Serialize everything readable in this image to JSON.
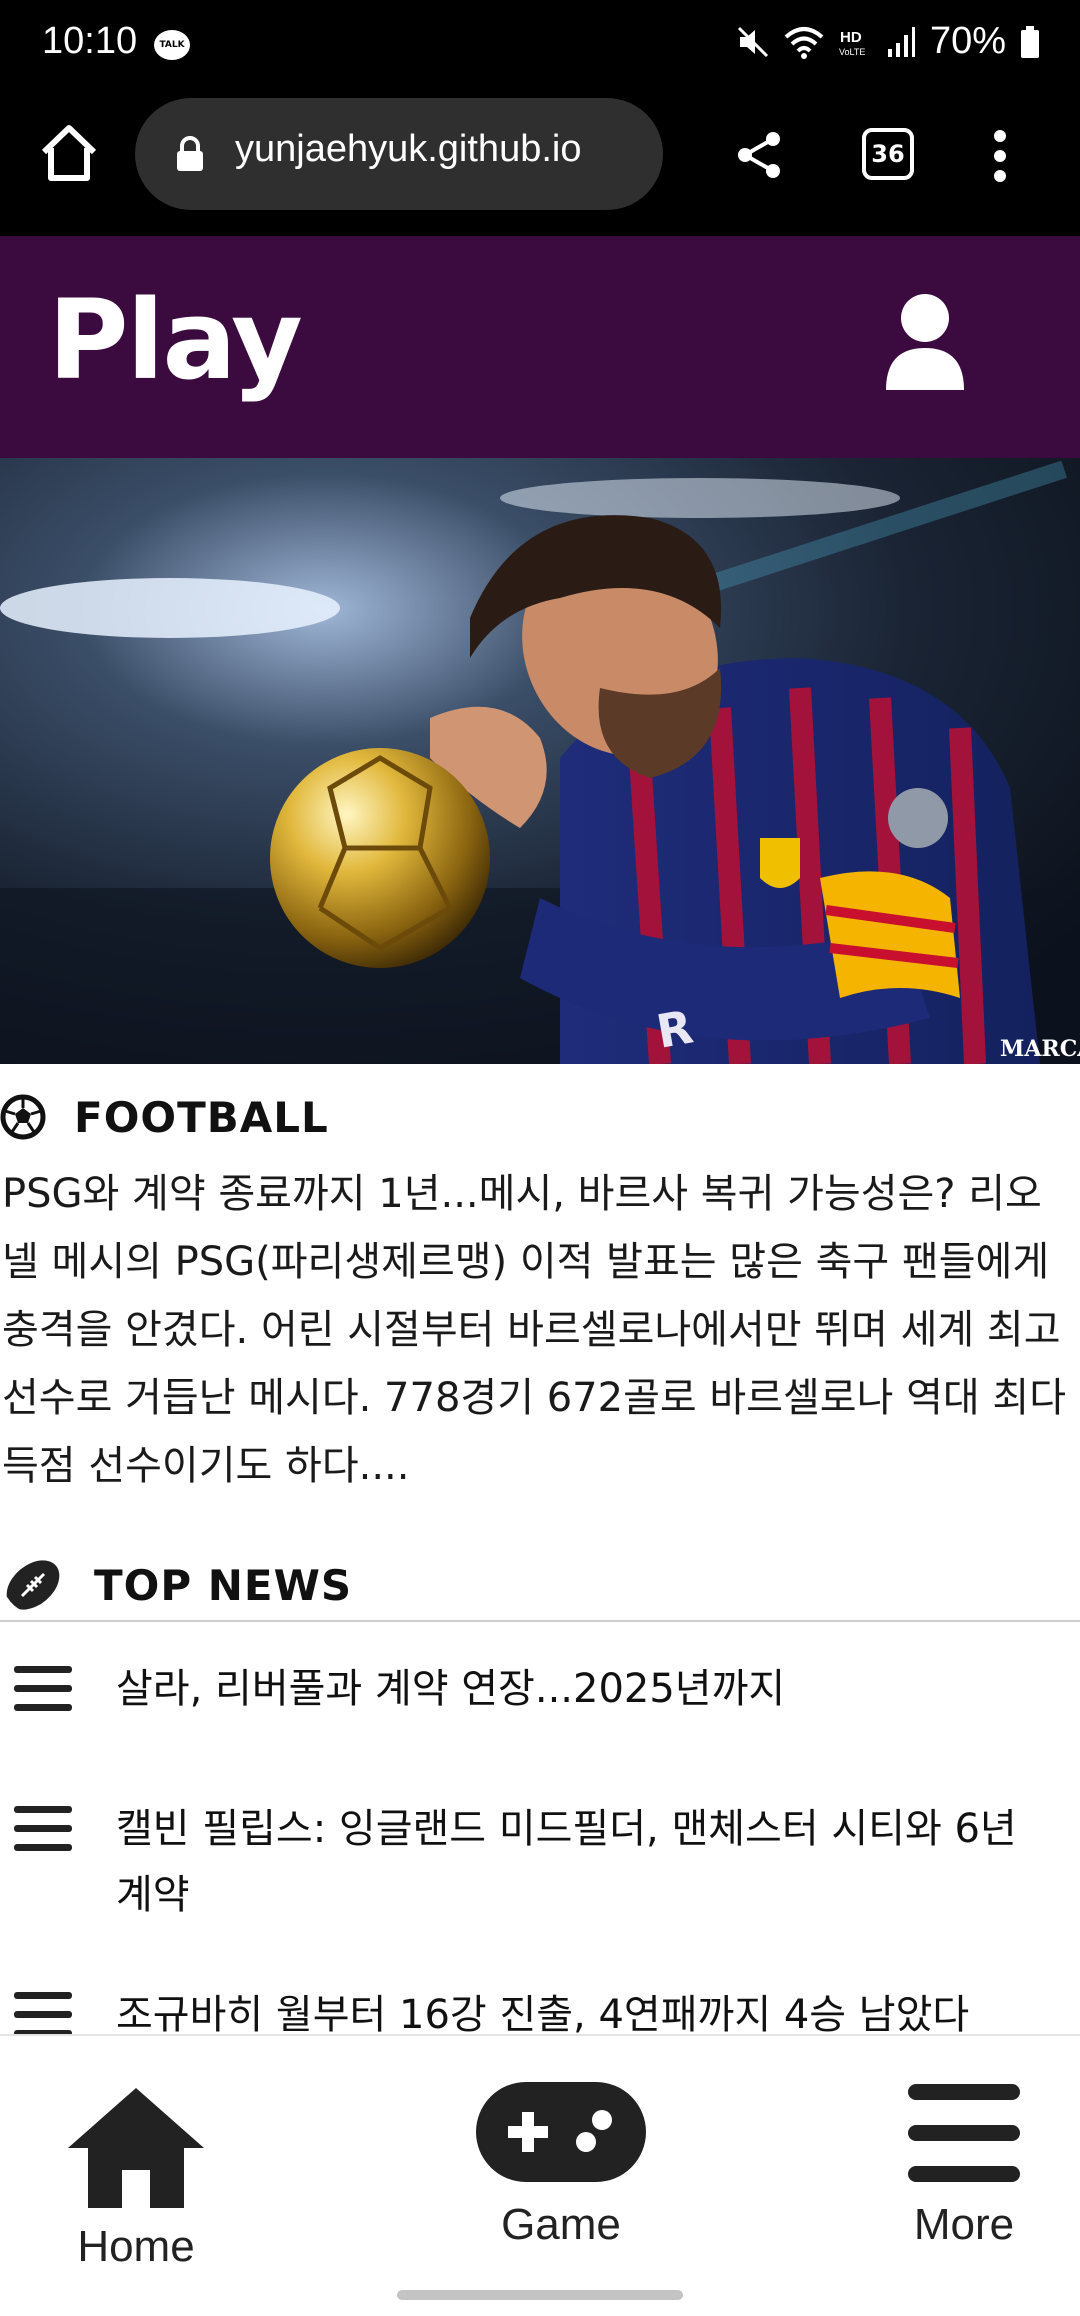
{
  "status_bar": {
    "time": "10:10",
    "talk_badge": "TALK",
    "battery": "70%"
  },
  "browser": {
    "url": "yunjaehyuk.github.io",
    "tab_count": "36"
  },
  "app": {
    "title": "Play"
  },
  "hero": {
    "watermark": "MARCA"
  },
  "football": {
    "label": "FOOTBALL",
    "article": "PSG와 계약 종료까지 1년...메시, 바르사 복귀 가능성은? 리오넬 메시의 PSG(파리생제르맹) 이적 발표는 많은 축구 팬들에게 충격을 안겼다. 어린 시절부터 바르셀로나에서만 뛰며 세계 최고 선수로 거듭난 메시다. 778경기 672골로 바르셀로나 역대 최다 득점 선수이기도 하다...."
  },
  "top_news": {
    "label": "TOP NEWS",
    "items": [
      "살라, 리버풀과 계약 연장...2025년까지",
      "캘빈 필립스: 잉글랜드 미드필더, 맨체스터 시티와 6년 계약",
      "조규바히 월부터 16강 진출, 4연패까지 4승 남았다"
    ]
  },
  "bottom_nav": {
    "home": "Home",
    "game": "Game",
    "more": "More"
  }
}
